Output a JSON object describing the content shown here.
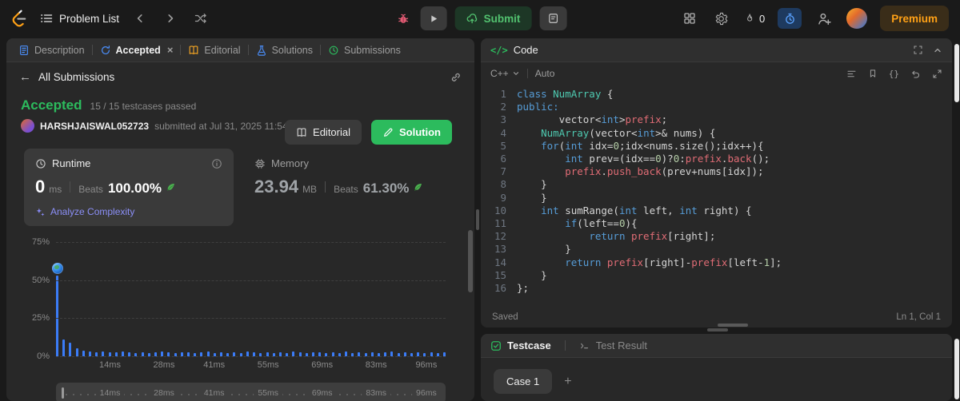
{
  "icons": {
    "code_glyph": "</>",
    "back_arrow": "←",
    "close": "×",
    "plus": "+",
    "braces": "{}"
  },
  "topbar": {
    "problem_list": "Problem List",
    "submit_label": "Submit",
    "streak_count": "0",
    "premium_label": "Premium"
  },
  "left_tabs": [
    {
      "label": "Description"
    },
    {
      "label": "Accepted"
    },
    {
      "label": "Editorial"
    },
    {
      "label": "Solutions"
    },
    {
      "label": "Submissions"
    }
  ],
  "submission": {
    "back_label": "All Submissions",
    "status": "Accepted",
    "testcases": "15 / 15 testcases passed",
    "user": "HARSHJAISWAL052723",
    "submitted_at": "submitted at Jul 31, 2025 11:54",
    "editorial_button": "Editorial",
    "solution_button": "Solution",
    "runtime": {
      "label": "Runtime",
      "value": "0",
      "unit": "ms",
      "beats_label": "Beats",
      "beats_value": "100.00%",
      "analyze_label": "Analyze Complexity"
    },
    "memory": {
      "label": "Memory",
      "value": "23.94",
      "unit": "MB",
      "beats_label": "Beats",
      "beats_value": "61.30%"
    }
  },
  "chart_data": {
    "type": "bar",
    "x_ticks": [
      "14ms",
      "28ms",
      "41ms",
      "55ms",
      "69ms",
      "83ms",
      "96ms"
    ],
    "y_ticks": [
      "75%",
      "50%",
      "25%",
      "0%"
    ],
    "xlim": [
      0,
      101
    ],
    "ylim": [
      0,
      75
    ],
    "marker": {
      "bar_index": 0
    },
    "bars": [
      53,
      11,
      9,
      5,
      3.5,
      3,
      2.5,
      3,
      2.5,
      2.5,
      3,
      2.5,
      2,
      2.5,
      2,
      2.5,
      3,
      2.5,
      2,
      2.5,
      2.5,
      2,
      2.5,
      3,
      2,
      2.5,
      2,
      2.5,
      2,
      3,
      2.5,
      2,
      2.5,
      2,
      2.5,
      2,
      3,
      2.5,
      2,
      2.5,
      2.5,
      2,
      2.5,
      2,
      3,
      2,
      2.5,
      2,
      2.5,
      2,
      2.5,
      3,
      2,
      2.5,
      2,
      2.5,
      2,
      2.5,
      2,
      2.5
    ]
  },
  "editor": {
    "panel_title": "Code",
    "language_label": "C++",
    "auto_label": "Auto",
    "saved_label": "Saved",
    "cursor_label": "Ln 1, Col 1"
  },
  "code": {
    "language": "C++",
    "lines": [
      [
        [
          "class ",
          "k"
        ],
        [
          "NumArray",
          "t"
        ],
        [
          " {",
          "p"
        ]
      ],
      [
        [
          "public:",
          "k"
        ]
      ],
      [
        [
          "       vector<",
          "p"
        ],
        [
          "int",
          "k"
        ],
        [
          ">",
          "p"
        ],
        [
          "prefix",
          "m"
        ],
        [
          ";",
          "p"
        ]
      ],
      [
        [
          "    ",
          "p"
        ],
        [
          "NumArray",
          "t"
        ],
        [
          "(vector<",
          "p"
        ],
        [
          "int",
          "k"
        ],
        [
          ">& nums) {",
          "p"
        ]
      ],
      [
        [
          "    ",
          "p"
        ],
        [
          "for",
          "k"
        ],
        [
          "(",
          "p"
        ],
        [
          "int",
          "k"
        ],
        [
          " idx=",
          "p"
        ],
        [
          "0",
          "n"
        ],
        [
          ";idx<nums.size();idx++){",
          "p"
        ]
      ],
      [
        [
          "        ",
          "p"
        ],
        [
          "int",
          "k"
        ],
        [
          " prev=(idx==",
          "p"
        ],
        [
          "0",
          "n"
        ],
        [
          ")?",
          "p"
        ],
        [
          "0",
          "n"
        ],
        [
          ":",
          "p"
        ],
        [
          "prefix",
          "m"
        ],
        [
          ".",
          "p"
        ],
        [
          "back",
          "m"
        ],
        [
          "();",
          "p"
        ]
      ],
      [
        [
          "        ",
          "p"
        ],
        [
          "prefix",
          "m"
        ],
        [
          ".",
          "p"
        ],
        [
          "push_back",
          "m"
        ],
        [
          "(prev+nums[idx]);",
          "p"
        ]
      ],
      [
        [
          "    }",
          "p"
        ]
      ],
      [
        [
          "    }",
          "p"
        ]
      ],
      [
        [
          "    ",
          "p"
        ],
        [
          "int",
          "k"
        ],
        [
          " sumRange(",
          "p"
        ],
        [
          "int",
          "k"
        ],
        [
          " left, ",
          "p"
        ],
        [
          "int",
          "k"
        ],
        [
          " right) {",
          "p"
        ]
      ],
      [
        [
          "        ",
          "p"
        ],
        [
          "if",
          "k"
        ],
        [
          "(left==",
          "p"
        ],
        [
          "0",
          "n"
        ],
        [
          "){",
          "p"
        ]
      ],
      [
        [
          "            ",
          "p"
        ],
        [
          "return",
          "k"
        ],
        [
          " ",
          "p"
        ],
        [
          "prefix",
          "m"
        ],
        [
          "[right];",
          "p"
        ]
      ],
      [
        [
          "        }",
          "p"
        ]
      ],
      [
        [
          "        ",
          "p"
        ],
        [
          "return",
          "k"
        ],
        [
          " ",
          "p"
        ],
        [
          "prefix",
          "m"
        ],
        [
          "[right]-",
          "p"
        ],
        [
          "prefix",
          "m"
        ],
        [
          "[left-",
          "p"
        ],
        [
          "1",
          "n"
        ],
        [
          "];",
          "p"
        ]
      ],
      [
        [
          "    }",
          "p"
        ]
      ],
      [
        [
          "};",
          "p"
        ]
      ]
    ]
  },
  "testcase": {
    "testcase_tab": "Testcase",
    "result_tab": "Test Result",
    "case_label": "Case 1"
  }
}
